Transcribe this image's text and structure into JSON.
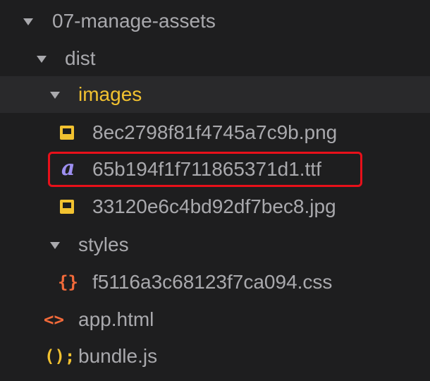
{
  "tree": {
    "root_folder": {
      "label": "07-manage-assets",
      "expanded": true
    },
    "dist_folder": {
      "label": "dist",
      "expanded": true
    },
    "images_folder": {
      "label": "images",
      "expanded": true,
      "selected": true
    },
    "images_files": [
      {
        "label": "8ec2798f81f4745a7c9b.png",
        "icon": "image-icon"
      },
      {
        "label": "65b194f1f711865371d1.ttf",
        "icon": "font-icon",
        "highlighted": true
      },
      {
        "label": "33120e6c4bd92df7bec8.jpg",
        "icon": "image-icon"
      }
    ],
    "styles_folder": {
      "label": "styles",
      "expanded": true
    },
    "styles_files": [
      {
        "label": "f5116a3c68123f7ca094.css",
        "icon": "css-braces-icon"
      }
    ],
    "dist_files": [
      {
        "label": "app.html",
        "icon": "html-tag-icon"
      },
      {
        "label": "bundle.js",
        "icon": "js-icon"
      }
    ]
  },
  "icon_glyphs": {
    "font": "a",
    "css": "{}",
    "html": "<>",
    "js": "();"
  },
  "colors": {
    "background": "#1e1e1f",
    "selected_row": "#29292b",
    "text": "#a9a9ad",
    "folder_highlight": "#f2c230",
    "image_icon": "#f2c230",
    "font_icon": "#9d8ff0",
    "css_icon": "#f26a3a",
    "html_icon": "#f26a3a",
    "js_icon": "#f2c230",
    "annotation_box": "#e8101a"
  }
}
